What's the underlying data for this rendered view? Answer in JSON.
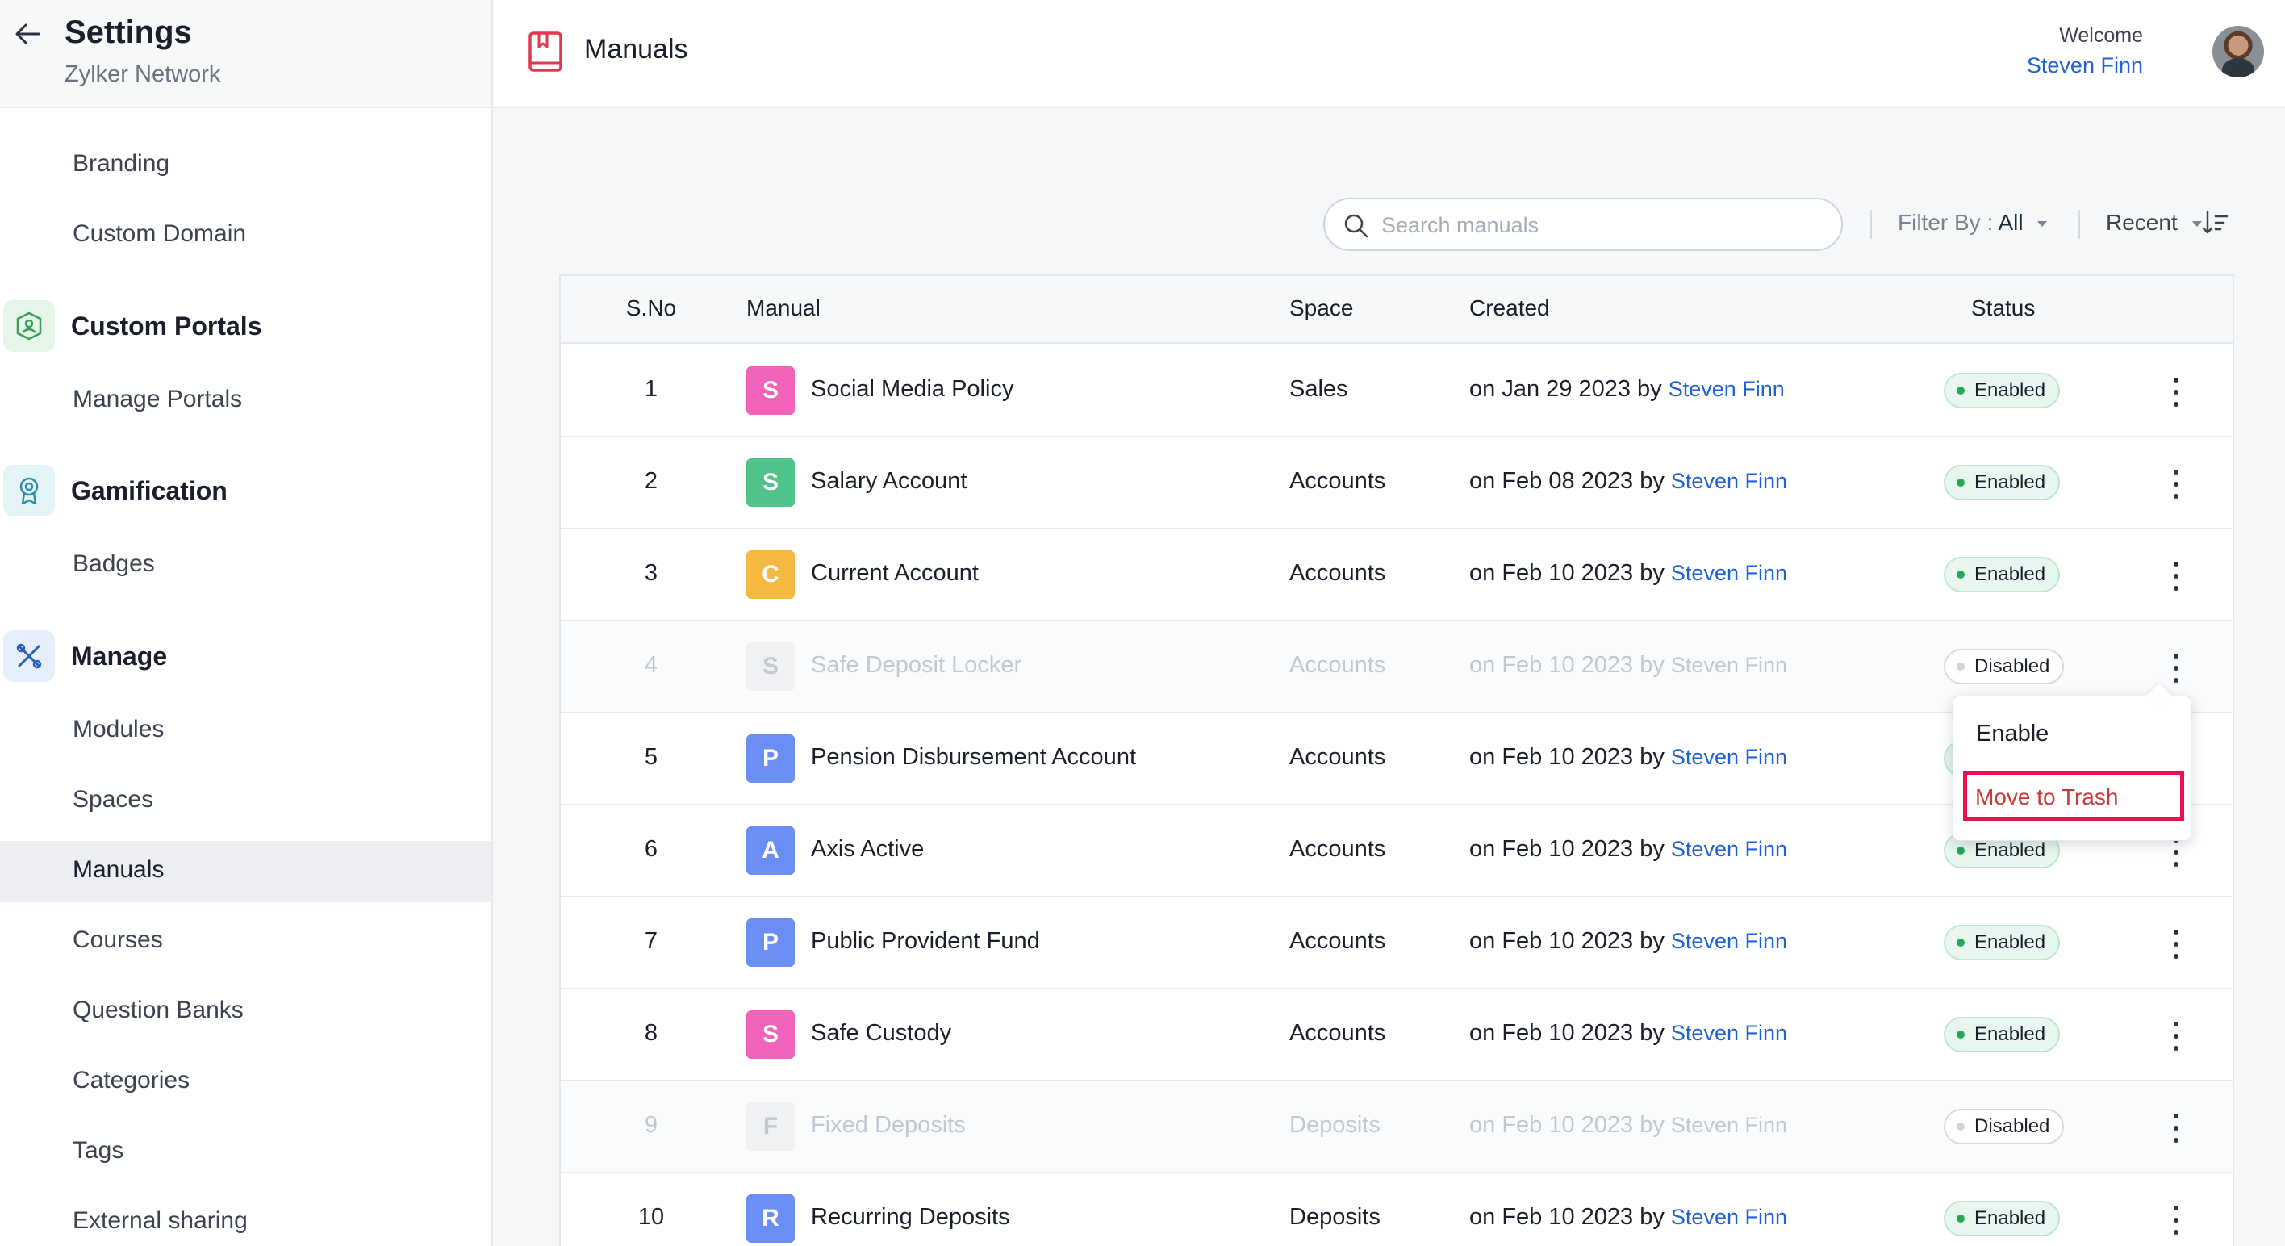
{
  "sidebar": {
    "title": "Settings",
    "subtitle": "Zylker Network",
    "top_items": [
      "Branding",
      "Custom Domain"
    ],
    "sections": [
      {
        "label": "Custom Portals",
        "icon": "portal-icon",
        "items": [
          "Manage Portals"
        ]
      },
      {
        "label": "Gamification",
        "icon": "badge-award-icon",
        "items": [
          "Badges"
        ]
      },
      {
        "label": "Manage",
        "icon": "tools-icon",
        "items": [
          "Modules",
          "Spaces",
          "Manuals",
          "Courses",
          "Question Banks",
          "Categories",
          "Tags",
          "External sharing"
        ]
      }
    ],
    "active_item": "Manuals"
  },
  "header": {
    "title": "Manuals",
    "welcome": "Welcome",
    "user_name": "Steven Finn"
  },
  "toolbar": {
    "search_placeholder": "Search manuals",
    "filter_label": "Filter By :",
    "filter_value": "All",
    "sort_label": "Recent"
  },
  "table": {
    "columns": [
      "S.No",
      "Manual",
      "Space",
      "Created",
      "Status"
    ],
    "rows": [
      {
        "sno": "1",
        "initial": "S",
        "color": "#f063b8",
        "name": "Social Media Policy",
        "space": "Sales",
        "created": "on Jan 29 2023 by",
        "by": "Steven Finn",
        "status": "Enabled",
        "disabled": false
      },
      {
        "sno": "2",
        "initial": "S",
        "color": "#4fc38a",
        "name": "Salary Account",
        "space": "Accounts",
        "created": "on Feb 08 2023 by",
        "by": "Steven Finn",
        "status": "Enabled",
        "disabled": false
      },
      {
        "sno": "3",
        "initial": "C",
        "color": "#f5b942",
        "name": "Current Account",
        "space": "Accounts",
        "created": "on Feb 10 2023 by",
        "by": "Steven Finn",
        "status": "Enabled",
        "disabled": false
      },
      {
        "sno": "4",
        "initial": "S",
        "color": "#f0f1f3",
        "name": "Safe Deposit Locker",
        "space": "Accounts",
        "created": "on Feb 10 2023 by",
        "by": "Steven Finn",
        "status": "Disabled",
        "disabled": true
      },
      {
        "sno": "5",
        "initial": "P",
        "color": "#6b8df6",
        "name": "Pension Disbursement Account",
        "space": "Accounts",
        "created": "on Feb 10 2023 by",
        "by": "Steven Finn",
        "status": "Enabled",
        "disabled": false
      },
      {
        "sno": "6",
        "initial": "A",
        "color": "#6b8df6",
        "name": "Axis Active",
        "space": "Accounts",
        "created": "on Feb 10 2023 by",
        "by": "Steven Finn",
        "status": "Enabled",
        "disabled": false
      },
      {
        "sno": "7",
        "initial": "P",
        "color": "#6b8df6",
        "name": "Public Provident Fund",
        "space": "Accounts",
        "created": "on Feb 10 2023 by",
        "by": "Steven Finn",
        "status": "Enabled",
        "disabled": false
      },
      {
        "sno": "8",
        "initial": "S",
        "color": "#f063b8",
        "name": "Safe Custody",
        "space": "Accounts",
        "created": "on Feb 10 2023 by",
        "by": "Steven Finn",
        "status": "Enabled",
        "disabled": false
      },
      {
        "sno": "9",
        "initial": "F",
        "color": "#f0f1f3",
        "name": "Fixed Deposits",
        "space": "Deposits",
        "created": "on Feb 10 2023 by",
        "by": "Steven Finn",
        "status": "Disabled",
        "disabled": true
      },
      {
        "sno": "10",
        "initial": "R",
        "color": "#6b8df6",
        "name": "Recurring Deposits",
        "space": "Deposits",
        "created": "on Feb 10 2023 by",
        "by": "Steven Finn",
        "status": "Enabled",
        "disabled": false
      }
    ]
  },
  "context_menu": {
    "enable_label": "Enable",
    "trash_label": "Move to Trash"
  },
  "colors": {
    "accent": "#1f62d6",
    "enabled_dot": "#23a85a",
    "highlight": "#e8114f"
  }
}
